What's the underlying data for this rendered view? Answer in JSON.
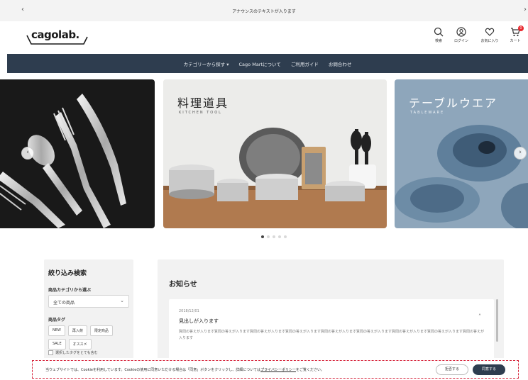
{
  "announcement": {
    "text": "アナウンスのテキストが入ります",
    "prev": "‹",
    "next": "›"
  },
  "header": {
    "logo_text": "cagolab.",
    "icons": [
      {
        "name": "search-icon",
        "label": "検索"
      },
      {
        "name": "login-icon",
        "label": "ログイン"
      },
      {
        "name": "favorites-icon",
        "label": "お気に入り"
      },
      {
        "name": "cart-icon",
        "label": "カート"
      }
    ],
    "cart_count": "0"
  },
  "nav": {
    "items": [
      "カテゴリーから探す ▾",
      "Cago Martについて",
      "ご利用ガイド",
      "お問合わせ"
    ]
  },
  "slider": {
    "slides": [
      {
        "title": "",
        "sub": ""
      },
      {
        "title": "料理道具",
        "sub": "KITCHEN TOOL"
      },
      {
        "title": "テーブルウエア",
        "sub": "TABLEWARE"
      }
    ],
    "prev": "‹",
    "next": "›",
    "dot_count": 5,
    "active_dot": 0
  },
  "filter": {
    "title": "絞り込み検索",
    "category_label": "商品カテゴリから選ぶ",
    "category_value": "全ての商品",
    "tag_label": "商品タグ",
    "tags": [
      "NEW",
      "再入荷",
      "限定商品",
      "SALE",
      "オススメ"
    ],
    "checkbox_label": "選択したタグをとても含む"
  },
  "news": {
    "title": "お知らせ",
    "item": {
      "date": "2018/12/01",
      "heading": "見出しが入ります",
      "body": "質問の答えが入ります質問の答えが入ります質問の答えが入ります質問の答えが入ります質問の答えが入ります質問の答えが入ります質問の答えが入ります質問の答えが入ります質問の答えが入ります",
      "toggle": "˄"
    }
  },
  "cookie": {
    "text_before": "当ウェブサイトでは、Cookieを利用しています。Cookieの使用に同意いただける場合は「同意」ボタンをクリックし、詳細については",
    "link": "プライバシーポリシー",
    "text_after": "をご覧ください。",
    "reject_label": "拒否する",
    "accept_label": "同意する"
  },
  "colors": {
    "nav_bg": "#2e3d4f",
    "badge": "#e8262c",
    "cookie_border": "#d7263d"
  }
}
